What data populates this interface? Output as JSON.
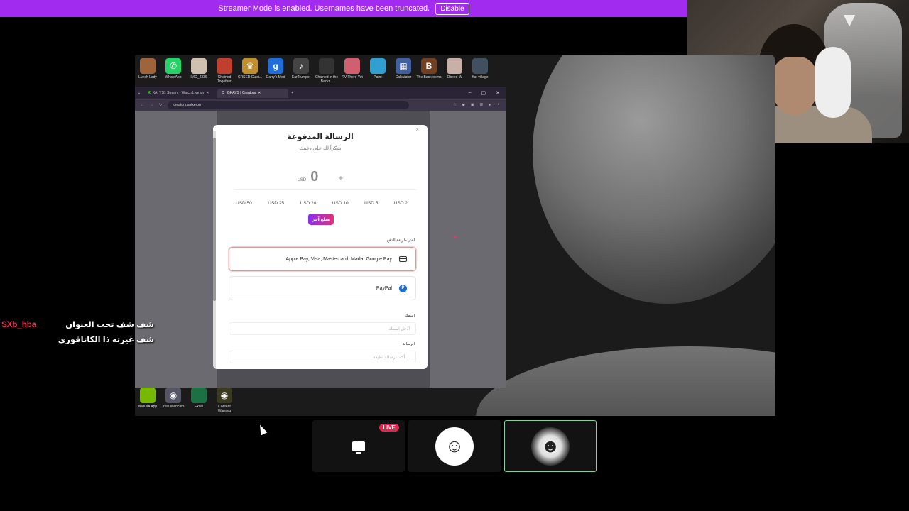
{
  "banner": {
    "text": "Streamer Mode is enabled. Usernames have been truncated.",
    "button": "Disable",
    "color": "#a12cf0"
  },
  "desktop": {
    "top_icons": [
      {
        "label": "Lunch Lady",
        "color": "#a0643a",
        "glyph": ""
      },
      {
        "label": "WhatsApp",
        "color": "#25d366",
        "glyph": "✆"
      },
      {
        "label": "IMG_4336",
        "color": "#d0c0b0",
        "glyph": ""
      },
      {
        "label": "Chained Together",
        "color": "#c04030",
        "glyph": ""
      },
      {
        "label": "CRSED Cuisi...",
        "color": "#c09030",
        "glyph": "♛"
      },
      {
        "label": "Garry's Mod",
        "color": "#1e6fd9",
        "glyph": "g"
      },
      {
        "label": "EarTrumpet",
        "color": "#444",
        "glyph": "♪"
      },
      {
        "label": "Chained in the Backr...",
        "color": "#333",
        "glyph": ""
      },
      {
        "label": "RV There Yet",
        "color": "#d06070",
        "glyph": ""
      },
      {
        "label": "Paint",
        "color": "#2fa0d0",
        "glyph": ""
      },
      {
        "label": "Calculator",
        "color": "#4060a0",
        "glyph": "▦"
      },
      {
        "label": "The Backrooms",
        "color": "#704020",
        "glyph": "B"
      },
      {
        "label": "Obeed W",
        "color": "#c8b0a8",
        "glyph": ""
      },
      {
        "label": "Kaf village",
        "color": "#405060",
        "glyph": ""
      }
    ],
    "bottom_icons": [
      {
        "label": "NVIDIA App",
        "color": "#76b900",
        "glyph": ""
      },
      {
        "label": "Iriun Webcam",
        "color": "#556",
        "glyph": "◉"
      },
      {
        "label": "Excel",
        "color": "#1d7044",
        "glyph": ""
      },
      {
        "label": "Content Warning",
        "color": "#3a3a20",
        "glyph": "◉"
      }
    ]
  },
  "browser": {
    "tabs": [
      {
        "label": "KA_YS1 Stream - Watch Live on",
        "icon": "K"
      },
      {
        "label": "@KAYS | Creators",
        "icon": "C"
      }
    ],
    "new_tab": "+",
    "url": "creators.sa/xeroq",
    "window_controls": [
      "–",
      "▢",
      "✕"
    ]
  },
  "modal": {
    "title": "الرسالة المدفوعة",
    "subtitle": "شكراً لك على دعمك",
    "currency": "USD",
    "amount": "0",
    "presets": [
      "USD 50",
      "USD 25",
      "USD 20",
      "USD 10",
      "USD 5",
      "USD 2"
    ],
    "other_amount": "مبلغ آخر",
    "payment_label": "اختر طريقة الدفع",
    "payment_methods": [
      "Apple Pay, Visa, Mastercard, Mada, Google Pay",
      "PayPal"
    ],
    "name_label": "اسمك",
    "name_placeholder": "أدخل اسمك",
    "message_label": "الرسالة",
    "message_placeholder": "أكتب رسالة لطيفة ..."
  },
  "chat": {
    "username": "SXb_hba",
    "message": "شف شف تحت العنوان شف غيرته ذا الكاتاقوري",
    "username_color": "#e3364a"
  },
  "participants": {
    "live_badge": "LIVE"
  }
}
